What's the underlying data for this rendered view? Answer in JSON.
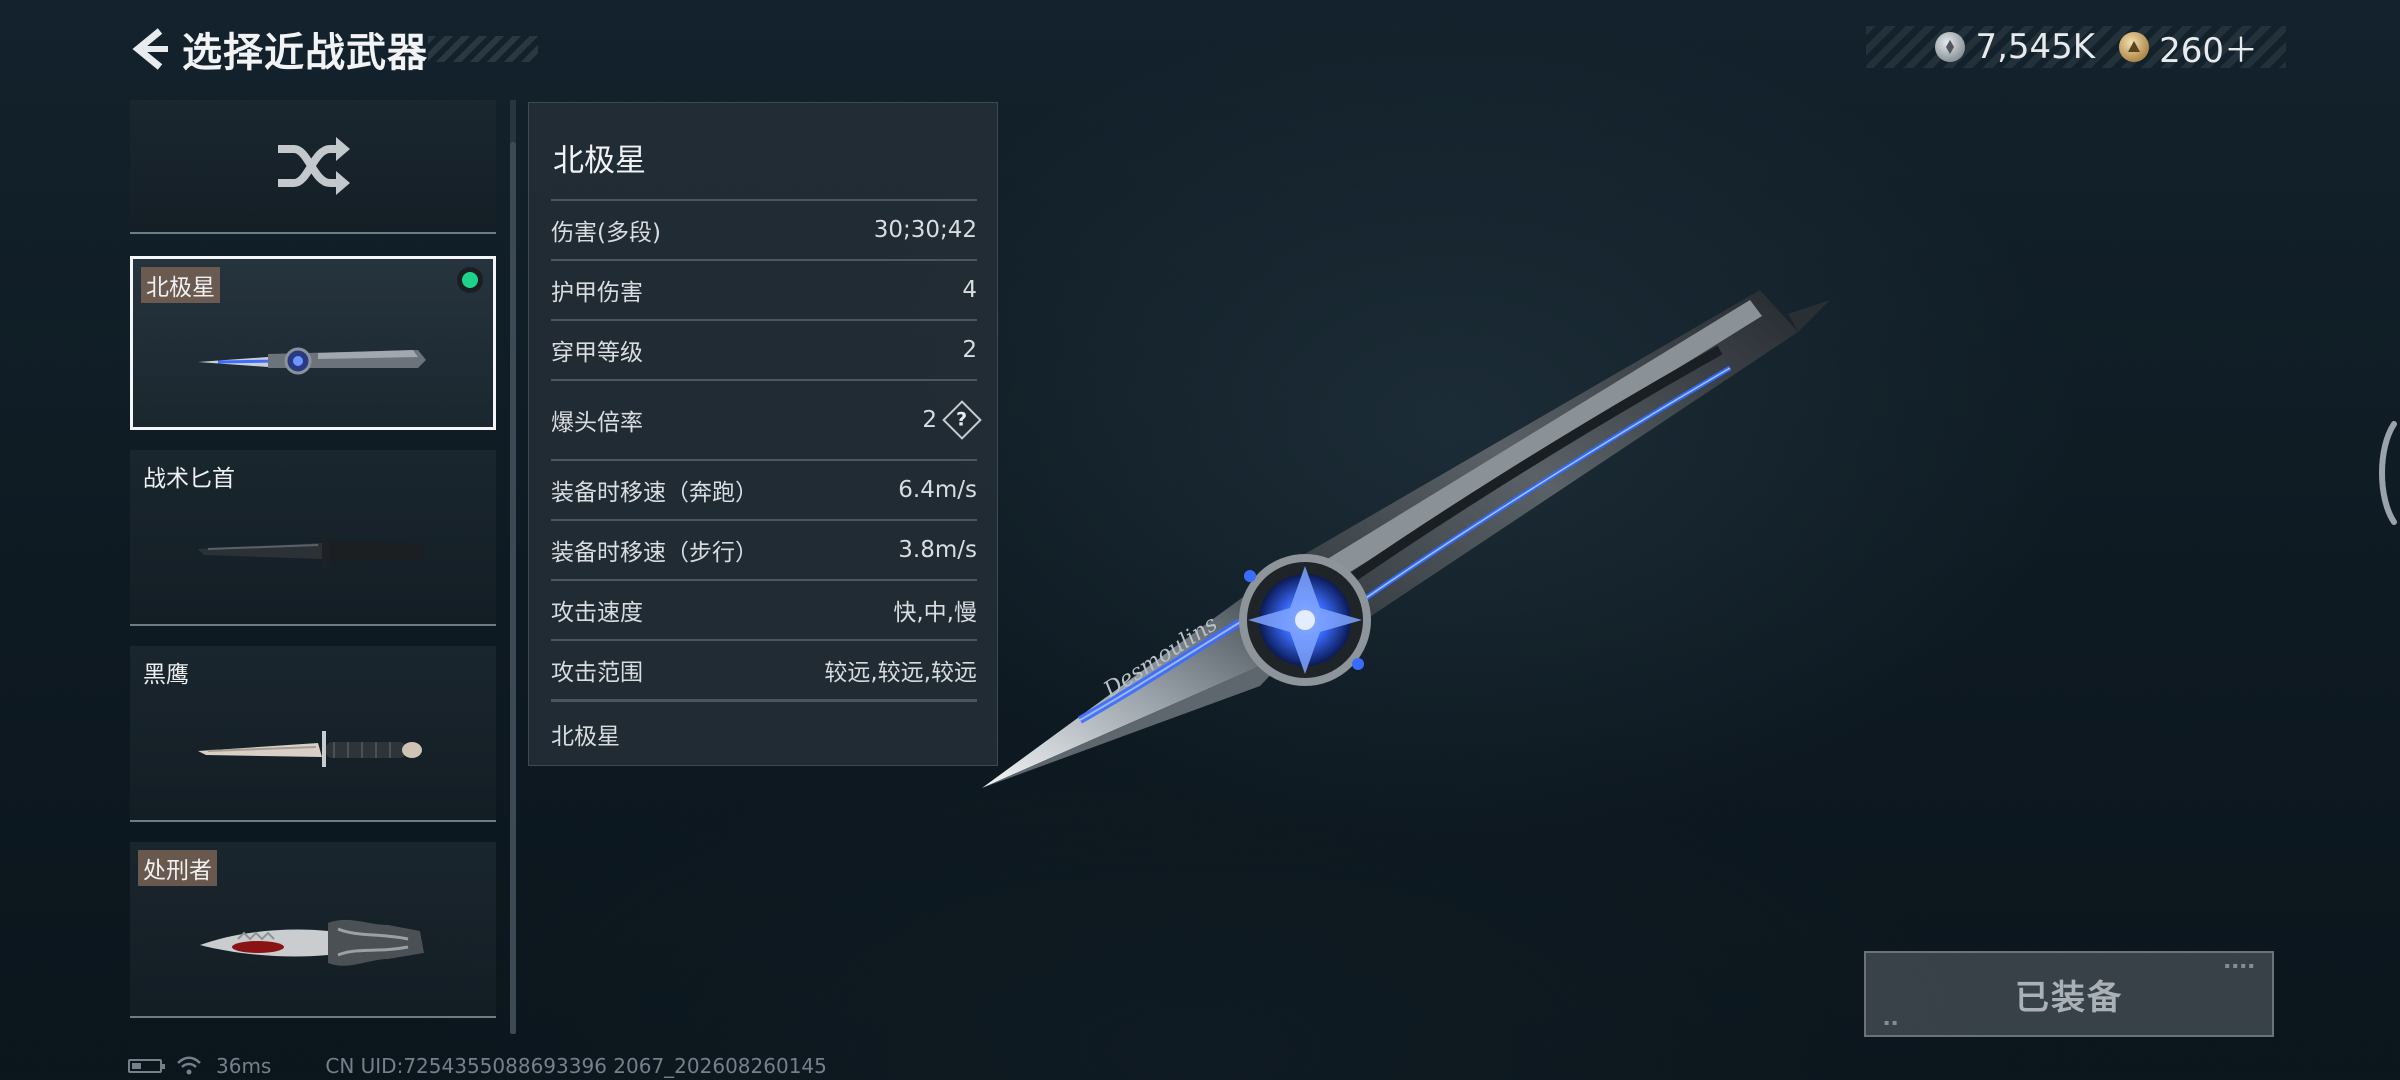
{
  "header": {
    "title": "选择近战武器",
    "back_icon": "back-arrow-icon"
  },
  "currency": {
    "silver": {
      "icon": "silver-coin-icon",
      "value": "7,545K"
    },
    "gold": {
      "icon": "gold-coin-icon",
      "value": "260＋"
    }
  },
  "weapon_list": {
    "random_icon": "shuffle-icon",
    "items": [
      {
        "label": "北极星",
        "selected": true,
        "equipped": true,
        "tagged": true
      },
      {
        "label": "战术匕首",
        "selected": false,
        "equipped": false,
        "tagged": false
      },
      {
        "label": "黑鹰",
        "selected": false,
        "equipped": false,
        "tagged": false
      },
      {
        "label": "处刑者",
        "selected": false,
        "equipped": false,
        "tagged": true
      }
    ]
  },
  "stats": {
    "title": "北极星",
    "rows": [
      {
        "label": "伤害(多段)",
        "value": "30;30;42"
      },
      {
        "label": "护甲伤害",
        "value": "4"
      },
      {
        "label": "穿甲等级",
        "value": "2"
      },
      {
        "label": "爆头倍率",
        "value": "2",
        "help": "?"
      },
      {
        "label": "装备时移速（奔跑）",
        "value": "6.4m/s"
      },
      {
        "label": "装备时移速（步行）",
        "value": "3.8m/s"
      },
      {
        "label": "攻击速度",
        "value": "快,中,慢"
      },
      {
        "label": "攻击范围",
        "value": "较远,较远,较远"
      }
    ],
    "footer_name": "北极星"
  },
  "knife_engraving": "Desmoulins",
  "equip_button": {
    "label": "已装备"
  },
  "footer": {
    "ping": "36ms",
    "uid": "CN UID:7254355088693396 2067_202608260145"
  },
  "colors": {
    "equipped_dot": "#1fd28b",
    "tag_bg": "#786254",
    "knife_glow": "#3a6cff"
  }
}
